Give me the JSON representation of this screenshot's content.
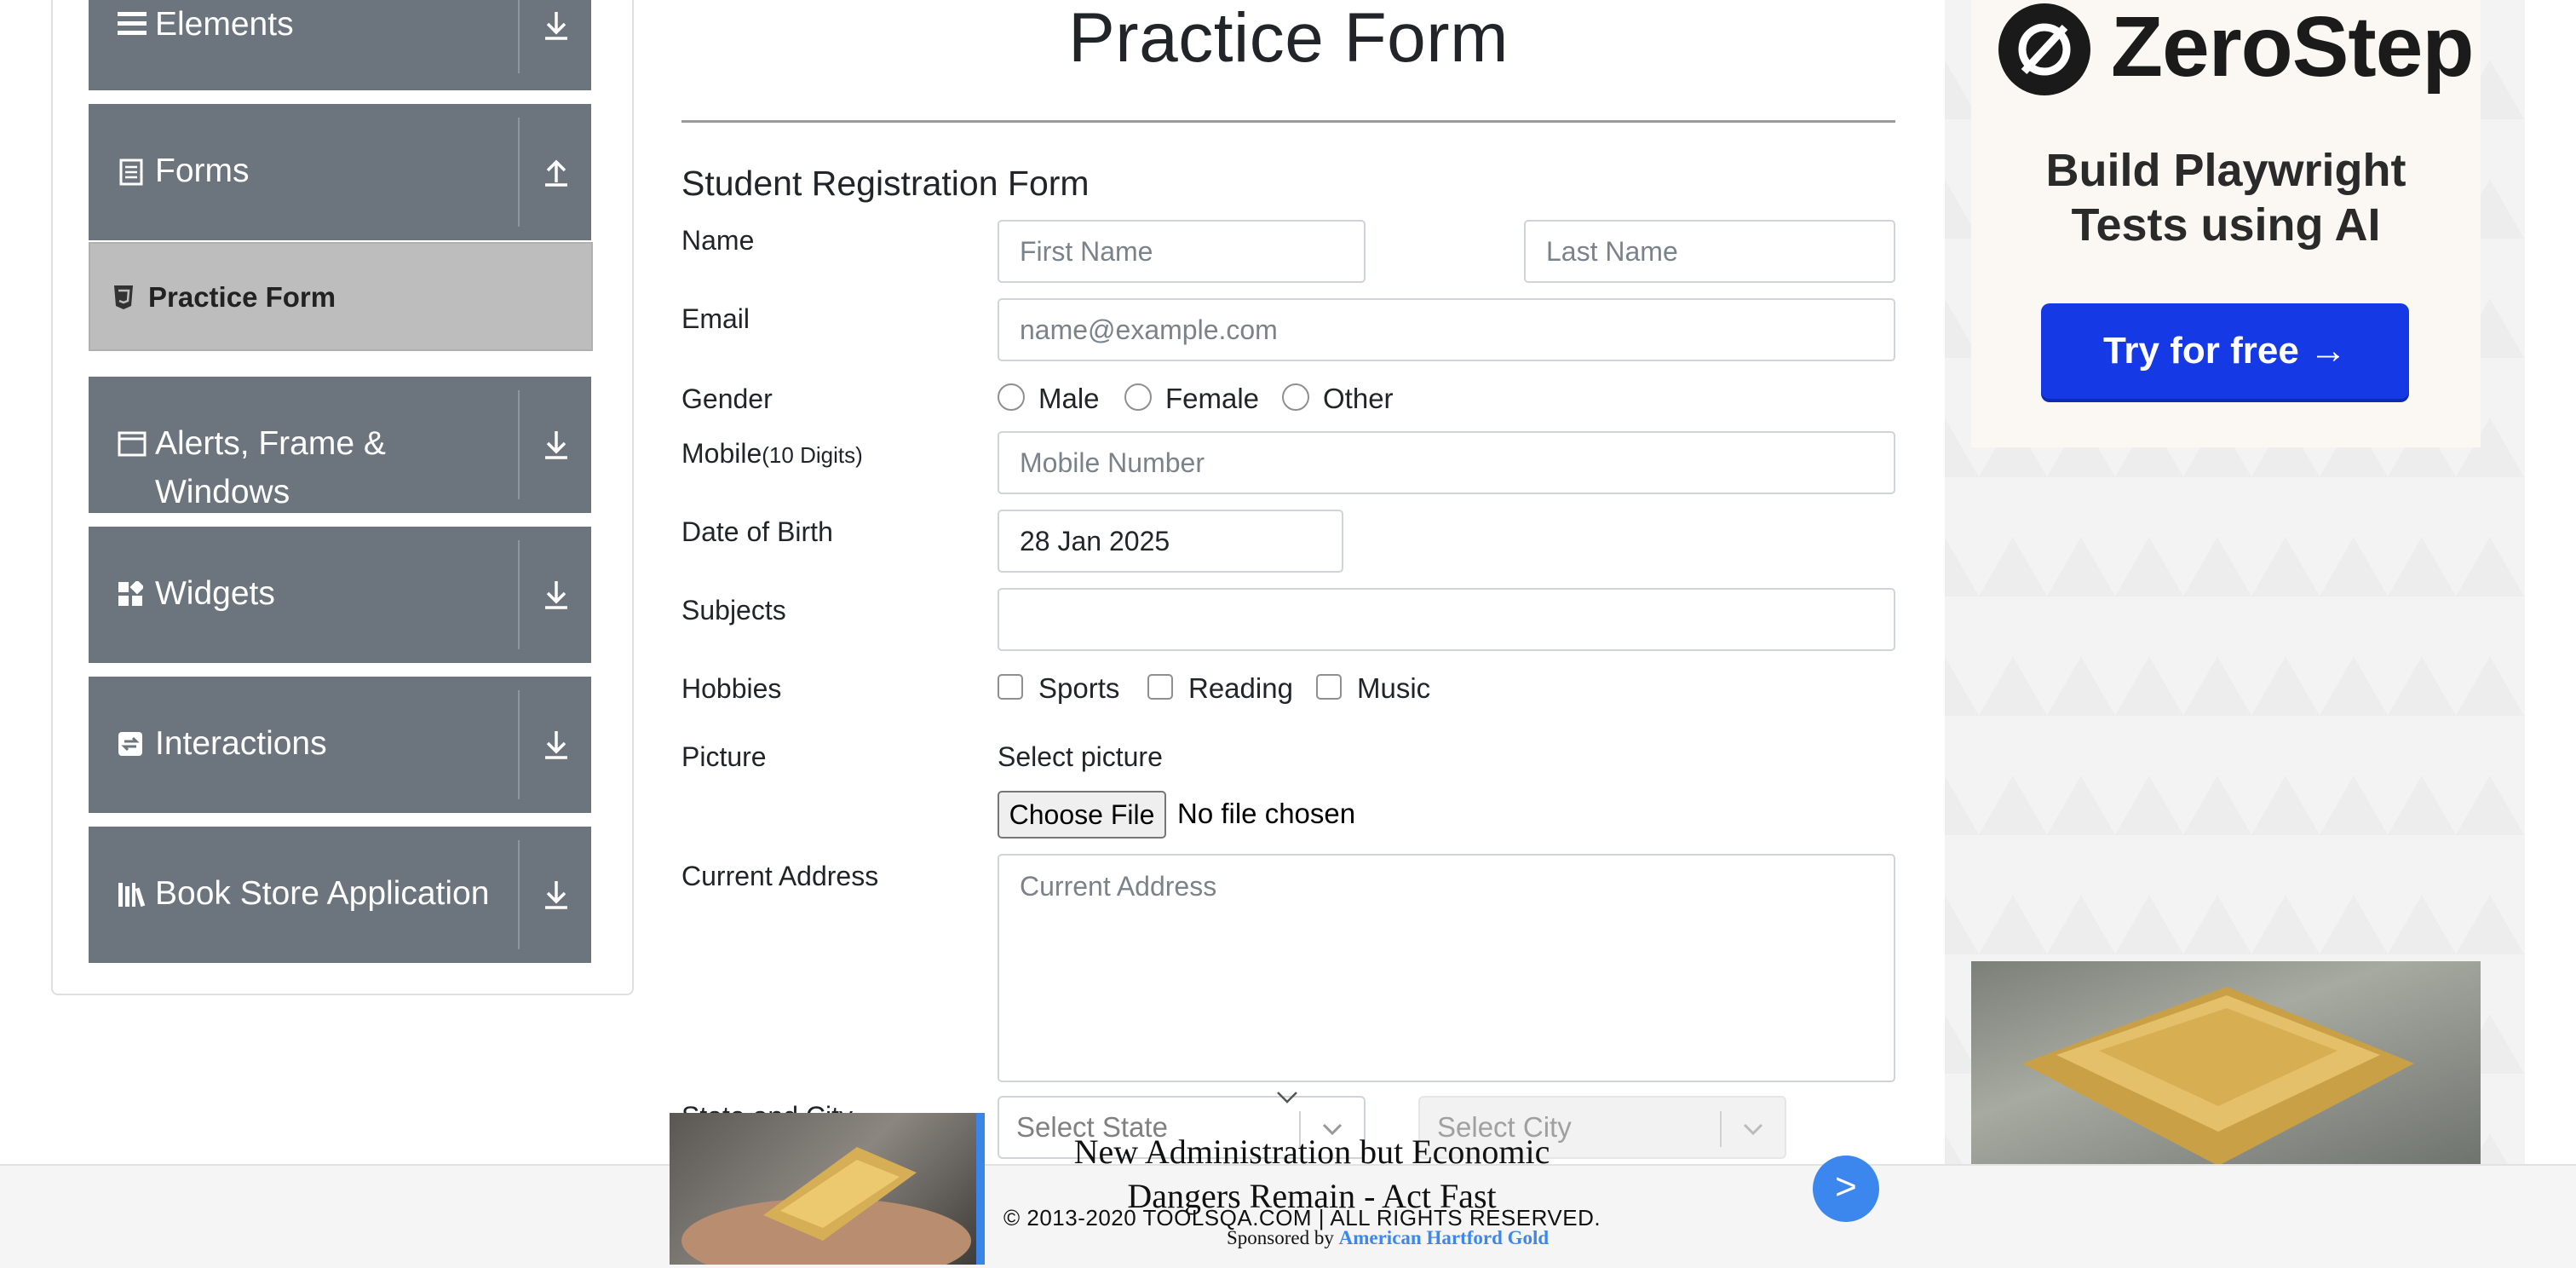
{
  "sidebar": {
    "groups": [
      {
        "label": "Elements",
        "icon": "hamburger-icon"
      },
      {
        "label": "Forms",
        "icon": "document-icon"
      },
      {
        "label": "Alerts, Frame &",
        "label2": "Windows",
        "icon": "window-icon"
      },
      {
        "label": "Widgets",
        "icon": "widgets-icon"
      },
      {
        "label": "Interactions",
        "icon": "interactions-icon"
      },
      {
        "label": "Book Store Application",
        "icon": "books-icon"
      }
    ],
    "active_item": {
      "label": "Practice Form",
      "icon": "html5-icon"
    }
  },
  "form": {
    "page_title": "Practice Form",
    "form_title": "Student Registration Form",
    "name_label": "Name",
    "first_name_placeholder": "First Name",
    "last_name_placeholder": "Last Name",
    "email_label": "Email",
    "email_placeholder": "name@example.com",
    "gender_label": "Gender",
    "gender_options": [
      "Male",
      "Female",
      "Other"
    ],
    "mobile_label": "Mobile",
    "mobile_hint": "(10 Digits)",
    "mobile_placeholder": "Mobile Number",
    "dob_label": "Date of Birth",
    "dob_value": "28 Jan 2025",
    "subjects_label": "Subjects",
    "subjects_value": "",
    "hobbies_label": "Hobbies",
    "hobbies_options": [
      "Sports",
      "Reading",
      "Music"
    ],
    "picture_label": "Picture",
    "select_picture": "Select picture",
    "choose_file": "Choose File",
    "no_file": "No file chosen",
    "address_label": "Current Address",
    "address_placeholder": "Current Address",
    "state_city_label": "State and City",
    "state_placeholder": "Select State",
    "city_placeholder": "Select City"
  },
  "ads": {
    "zerostep_brand": "ZeroStep",
    "zerostep_line1": "Build Playwright",
    "zerostep_line2": "Tests using AI",
    "zerostep_cta": "Try for free →",
    "bottom_headline": "New Administration but Economic Dangers Remain - Act Fast",
    "bottom_go": ">",
    "sponsored_by": "Sponsored by",
    "sponsor_name": "American Hartford Gold"
  },
  "footer": {
    "copyright": "© 2013-2020 TOOLSQA.COM | ALL RIGHTS RESERVED."
  },
  "colors": {
    "sidebar_group": "#6c757d",
    "active_item": "#bdbdbd",
    "cta_blue": "#1639e6",
    "accent_blue": "#3b87ee"
  }
}
